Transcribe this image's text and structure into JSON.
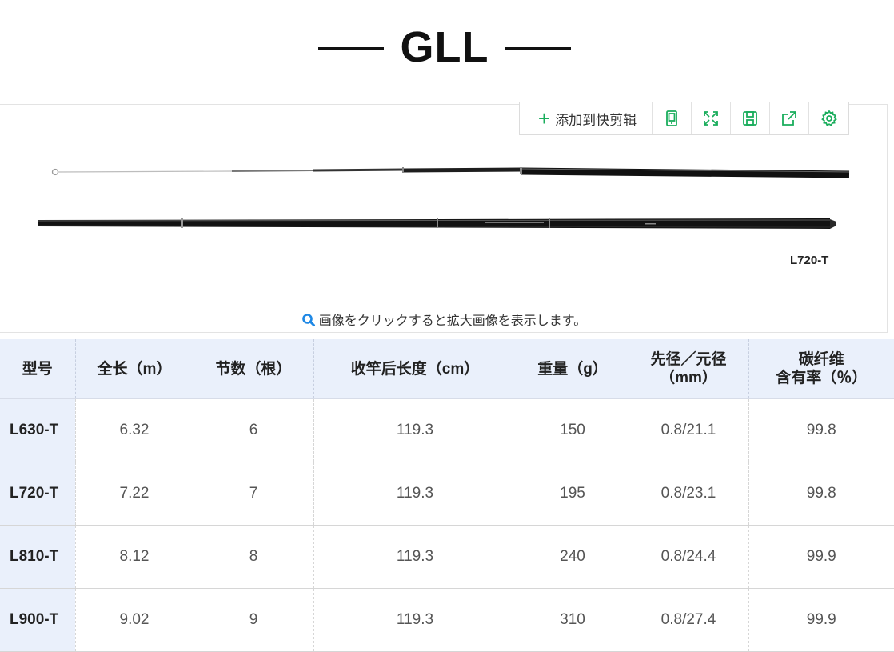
{
  "title": "GLL",
  "toolbar": {
    "add_label": "添加到快剪辑",
    "icons": [
      "tablet-icon",
      "fullscreen-icon",
      "save-icon",
      "share-icon",
      "settings-icon"
    ]
  },
  "image": {
    "rod_caption": "L720-T",
    "zoom_hint": "画像をクリックすると拡大画像を表示します。"
  },
  "colors": {
    "accent_green": "#1aad5c",
    "header_bg": "#eaf0fb",
    "zoom_icon_blue": "#1e88e5"
  },
  "table": {
    "headers": [
      [
        "型号"
      ],
      [
        "全长（m）"
      ],
      [
        "节数（根）"
      ],
      [
        "收竿后长度（cm）"
      ],
      [
        "重量（g）"
      ],
      [
        "先径／元径",
        "（mm）"
      ],
      [
        "碳纤维",
        "含有率（％）"
      ]
    ],
    "rows": [
      [
        "L630-T",
        "6.32",
        "6",
        "119.3",
        "150",
        "0.8/21.1",
        "99.8"
      ],
      [
        "L720-T",
        "7.22",
        "7",
        "119.3",
        "195",
        "0.8/23.1",
        "99.8"
      ],
      [
        "L810-T",
        "8.12",
        "8",
        "119.3",
        "240",
        "0.8/24.4",
        "99.9"
      ],
      [
        "L900-T",
        "9.02",
        "9",
        "119.3",
        "310",
        "0.8/27.4",
        "99.9"
      ]
    ]
  }
}
